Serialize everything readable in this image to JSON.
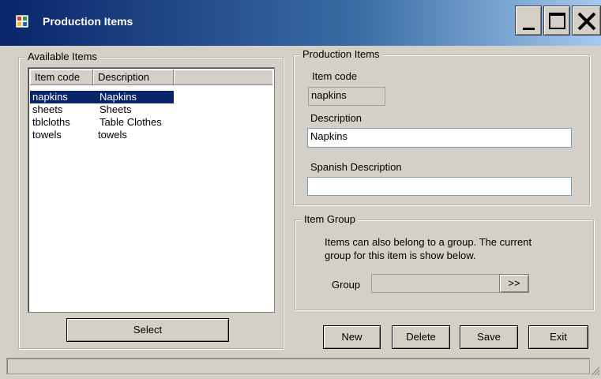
{
  "window": {
    "title": "Production Items"
  },
  "available_items": {
    "group_label": "Available Items",
    "columns": [
      "Item code",
      "Description"
    ],
    "rows": [
      {
        "code": "napkins",
        "description": "Napkins",
        "selected": true
      },
      {
        "code": "sheets",
        "description": "Sheets",
        "selected": false
      },
      {
        "code": "tblcloths",
        "description": "Table Clothes",
        "selected": false
      },
      {
        "code": "towels",
        "description": "towels",
        "selected": false
      }
    ],
    "select_label": "Select"
  },
  "production_items": {
    "group_label": "Production Items",
    "item_code_label": "Item code",
    "item_code_value": "napkins",
    "description_label": "Description",
    "description_value": "Napkins",
    "spanish_label": "Spanish Description",
    "spanish_value": ""
  },
  "item_group": {
    "group_label": "Item Group",
    "info_line1": "Items can also belong to a group. The current",
    "info_line2": "group for this item is show below.",
    "group_label_text": "Group",
    "group_value": "",
    "browse_label": ">>"
  },
  "actions": {
    "new": "New",
    "delete": "Delete",
    "save": "Save",
    "exit": "Exit"
  },
  "colors": {
    "face": "#d4d0c8",
    "selection": "#0a246a",
    "title_start": "#0a246a"
  }
}
